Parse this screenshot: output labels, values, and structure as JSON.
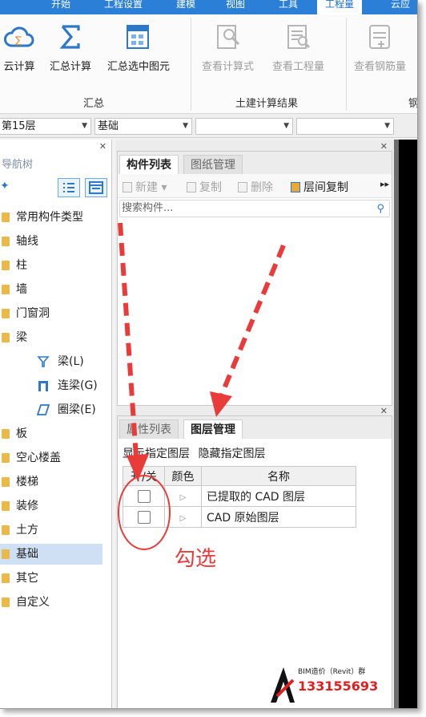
{
  "menu": {
    "tabs": [
      "开始",
      "工程设置",
      "建模",
      "视图",
      "工具",
      "工程量",
      "云应"
    ]
  },
  "ribbon": {
    "buttons": [
      {
        "label": "云计算",
        "icon": "cloud-calc-icon",
        "enabled": true
      },
      {
        "label": "汇总计算",
        "icon": "sigma-icon",
        "enabled": true
      },
      {
        "label": "汇总选中图元",
        "icon": "calc-selected-icon",
        "enabled": true
      },
      {
        "label": "查看计算式",
        "icon": "view-formula-icon",
        "enabled": false
      },
      {
        "label": "查看工程量",
        "icon": "view-quantity-icon",
        "enabled": false
      },
      {
        "label": "查看钢筋量",
        "icon": "view-rebar-icon",
        "enabled": false
      }
    ],
    "groups": [
      "汇总",
      "土建计算结果",
      "钢"
    ]
  },
  "selectors": {
    "floor": "第15层",
    "category": "基础",
    "type": "",
    "item": ""
  },
  "nav": {
    "title": "导航树",
    "items": [
      {
        "label": "常用构件类型",
        "level": 0
      },
      {
        "label": "轴线",
        "level": 0
      },
      {
        "label": "柱",
        "level": 0
      },
      {
        "label": "墙",
        "level": 0
      },
      {
        "label": "门窗洞",
        "level": 0
      },
      {
        "label": "梁",
        "level": 0
      },
      {
        "label": "梁(L)",
        "level": 1
      },
      {
        "label": "连梁(G)",
        "level": 1
      },
      {
        "label": "圈梁(E)",
        "level": 1
      },
      {
        "label": "板",
        "level": 0
      },
      {
        "label": "空心楼盖",
        "level": 0
      },
      {
        "label": "楼梯",
        "level": 0
      },
      {
        "label": "装修",
        "level": 0
      },
      {
        "label": "土方",
        "level": 0
      },
      {
        "label": "基础",
        "level": 0,
        "selected": true
      },
      {
        "label": "其它",
        "level": 0
      },
      {
        "label": "自定义",
        "level": 0
      }
    ]
  },
  "component_panel": {
    "tabs": [
      "构件列表",
      "图纸管理"
    ],
    "toolbar": {
      "new": "新建",
      "copy": "复制",
      "delete": "删除",
      "floor_copy": "层间复制"
    },
    "search_placeholder": "搜索构件..."
  },
  "layer_panel": {
    "tabs": [
      "属性列表",
      "图层管理"
    ],
    "show_link": "显示指定图层",
    "hide_link": "隐藏指定图层",
    "columns": [
      "开/关",
      "颜色",
      "名称"
    ],
    "rows": [
      {
        "name": "已提取的 CAD 图层",
        "checked": false
      },
      {
        "name": "CAD 原始图层",
        "checked": false
      }
    ]
  },
  "annotation": {
    "label": "勾选",
    "color": "#ea3b3b"
  },
  "watermark": {
    "line1": "BIM造价（Revit）群",
    "line2": "133155693"
  },
  "colors": {
    "menubar": "#2b7fd6",
    "selected": "#cfe0f4",
    "accent": "#2e78c9"
  }
}
